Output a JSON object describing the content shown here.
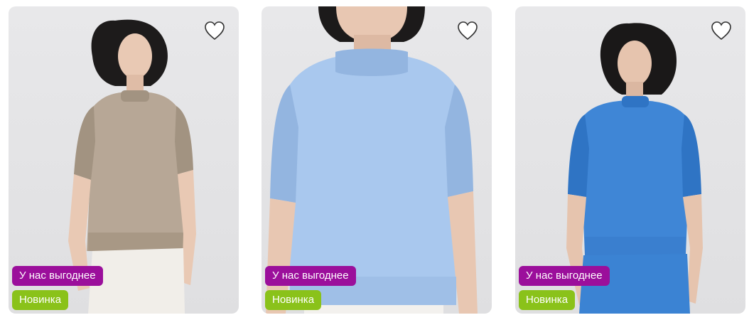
{
  "products": [
    {
      "image_alt": "Женщина в бежевом джемпере с коротким рукавом",
      "badges": {
        "promo": "У нас выгоднее",
        "new": "Новинка"
      },
      "colors": {
        "garment": "#b7a796",
        "garment_shadow": "#a29381",
        "pants": "#f1eee9",
        "hair": "#1d1b1b",
        "skin": "#e9c9b4"
      }
    },
    {
      "image_alt": "Женщина в голубом джемпере с коротким рукавом",
      "badges": {
        "promo": "У нас выгоднее",
        "new": "Новинка"
      },
      "colors": {
        "garment": "#a9c8ee",
        "garment_shadow": "#93b5e0",
        "pants": "#f3f1ee",
        "hair": "#1c1a1a",
        "skin": "#e8c7b2"
      }
    },
    {
      "image_alt": "Женщина в синем джемпере с коротким рукавом и юбке",
      "badges": {
        "promo": "У нас выгоднее",
        "new": "Новинка"
      },
      "colors": {
        "garment": "#3f86d6",
        "garment_shadow": "#2f74c4",
        "pants": "#3b83d3",
        "hair": "#1a1818",
        "skin": "#e6c4ae"
      }
    }
  ],
  "icons": {
    "favorite": "heart-outline-icon"
  },
  "theme": {
    "promo_badge": "#9b0f9b",
    "new_badge": "#8ac21a",
    "card_bg": "#e4e4e6"
  }
}
